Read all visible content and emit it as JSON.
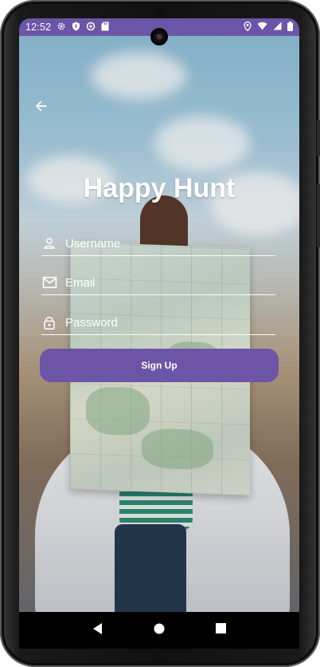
{
  "status_bar": {
    "time": "12:52",
    "left_icons": [
      "settings-icon",
      "shield-icon",
      "data-saver-icon",
      "sd-card-icon"
    ],
    "right_icons": [
      "location-icon",
      "wifi-icon",
      "signal-icon",
      "battery-icon"
    ],
    "color": "#6c55a6"
  },
  "screen": {
    "title": "Happy Hunt",
    "back_icon": "arrow-back-icon",
    "fields": {
      "username": {
        "placeholder": "Username",
        "value": "",
        "icon": "person-icon"
      },
      "email": {
        "placeholder": "Email",
        "value": "",
        "icon": "mail-icon"
      },
      "password": {
        "placeholder": "Password",
        "value": "",
        "icon": "lock-icon"
      }
    },
    "signup_label": "Sign Up",
    "accent_color": "#6c55a6"
  },
  "nav_bar": {
    "buttons": [
      "back-triangle-icon",
      "home-circle-icon",
      "recents-square-icon"
    ]
  }
}
